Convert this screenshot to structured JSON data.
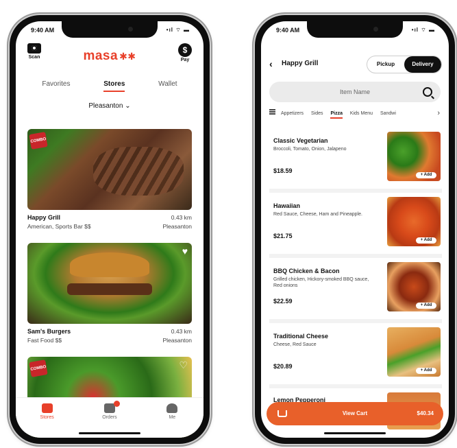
{
  "colors": {
    "accent": "#e8402a",
    "cart": "#e8602a",
    "dark": "#111111"
  },
  "left": {
    "status": {
      "time": "9:40 AM",
      "icons": "•ıl ⌔ ▬"
    },
    "header": {
      "camera_label": "Scan",
      "camera_icon": "camera-icon",
      "logo": "masa",
      "logo_mark": "✱✱",
      "pay_label": "Pay",
      "pay_symbol": "$",
      "pay_icon": "dollar-coin-icon"
    },
    "tabs": [
      {
        "label": "Favorites",
        "active": false
      },
      {
        "label": "Stores",
        "active": true
      },
      {
        "label": "Wallet",
        "active": false
      }
    ],
    "location": "Pleasanton ⌄",
    "stores": [
      {
        "name": "Happy Grill",
        "meta": "American, Sports Bar  $$",
        "distance": "0.43 km",
        "city": "Pleasanton",
        "badge": "COMBO",
        "favorite": false
      },
      {
        "name": "Sam's Burgers",
        "meta": "Fast Food  $$",
        "distance": "0.43 km",
        "city": "Pleasanton",
        "badge": "",
        "favorite": true
      },
      {
        "name": "",
        "meta": "",
        "distance": "",
        "city": "",
        "badge": "COMBO",
        "favorite": false
      }
    ],
    "bottom_nav": [
      {
        "label": "Stores",
        "icon": "store-icon",
        "active": true
      },
      {
        "label": "Orders",
        "icon": "orders-icon",
        "active": false
      },
      {
        "label": "Me",
        "icon": "person-icon",
        "active": false
      }
    ]
  },
  "right": {
    "status": {
      "time": "9:40 AM",
      "icons": "•ıl ⌔ ▬"
    },
    "header": {
      "back": "‹",
      "title": "Happy Grill",
      "pickup": "Pickup",
      "delivery": "Delivery"
    },
    "search": {
      "placeholder": "Item Name",
      "icon": "search-icon"
    },
    "categories": {
      "items": [
        "Appetizers",
        "Sides",
        "Pizza",
        "Kids Menu",
        "Sandwi"
      ],
      "active": "Pizza",
      "more": "›"
    },
    "menu": [
      {
        "name": "Classic Vegetarian",
        "desc": "Broccoli, Tomato, Onion, Jalapeno",
        "price": "$18.59",
        "add": "+ Add"
      },
      {
        "name": "Hawaiian",
        "desc": "Red Sauce, Cheese, Ham and Pineapple.",
        "price": "$21.75",
        "add": "+ Add"
      },
      {
        "name": "BBQ Chicken & Bacon",
        "desc": "Grilled chicken, Hickory-smoked BBQ sauce, Red onions",
        "price": "$22.59",
        "add": "+ Add"
      },
      {
        "name": "Traditional Cheese",
        "desc": "Cheese, Red Sauce",
        "price": "$20.89",
        "add": "+ Add"
      },
      {
        "name": "Lemon Pepperoni",
        "desc": "",
        "price": "",
        "add": ""
      }
    ],
    "cart": {
      "label": "View Cart",
      "amount": "$40.34",
      "icon": "cart-icon"
    }
  }
}
